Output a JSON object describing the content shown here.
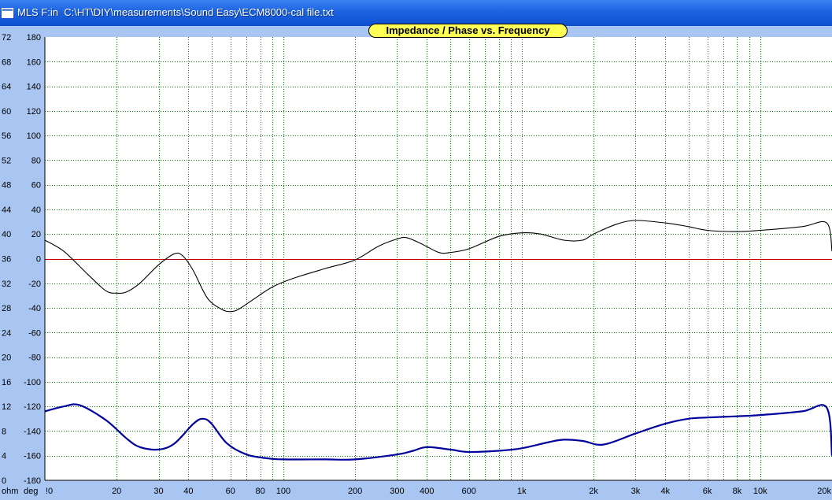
{
  "window": {
    "app": "MLS F:in",
    "path": "C:\\HT\\DIY\\measurements\\Sound Easy\\ECM8000-cal file.txt"
  },
  "colors": {
    "plot_background": "#ffffff",
    "grid": "#008000",
    "reference_line": "#c00000",
    "impedance": "#000000",
    "phase": "#00009c",
    "title_box": "#ffff55"
  },
  "chart_data": {
    "type": "line",
    "title": "Impedance / Phase vs. Frequency",
    "xscale": "log",
    "xlim": [
      10,
      20000
    ],
    "x_tick_labels": [
      {
        "value": 10,
        "label": "!0"
      },
      {
        "value": 20,
        "label": "20"
      },
      {
        "value": 30,
        "label": "30"
      },
      {
        "value": 40,
        "label": "40"
      },
      {
        "value": 60,
        "label": "60"
      },
      {
        "value": 80,
        "label": "80"
      },
      {
        "value": 100,
        "label": "100"
      },
      {
        "value": 200,
        "label": "200"
      },
      {
        "value": 300,
        "label": "300"
      },
      {
        "value": 400,
        "label": "400"
      },
      {
        "value": 600,
        "label": "600"
      },
      {
        "value": 1000,
        "label": "1k"
      },
      {
        "value": 2000,
        "label": "2k"
      },
      {
        "value": 3000,
        "label": "3k"
      },
      {
        "value": 4000,
        "label": "4k"
      },
      {
        "value": 6000,
        "label": "6k"
      },
      {
        "value": 8000,
        "label": "8k"
      },
      {
        "value": 10000,
        "label": "10k"
      },
      {
        "value": 20000,
        "label": "20k"
      }
    ],
    "x_gridlines": [
      10,
      20,
      30,
      40,
      50,
      60,
      70,
      80,
      90,
      100,
      200,
      300,
      400,
      500,
      600,
      700,
      800,
      900,
      1000,
      2000,
      3000,
      4000,
      5000,
      6000,
      7000,
      8000,
      9000,
      10000,
      20000
    ],
    "y_left": {
      "unit_label": "ohm",
      "ylim": [
        0,
        72
      ],
      "ticks": [
        "72",
        "68",
        "64",
        "60",
        "56",
        "52",
        "48",
        "44",
        "40",
        "36",
        "32",
        "28",
        "24",
        "20",
        "16",
        "12",
        "8",
        "4",
        "0"
      ]
    },
    "y_right": {
      "unit_label": "deg",
      "ylim": [
        -180,
        180
      ],
      "ticks": [
        "180",
        "160",
        "140",
        "120",
        "100",
        "80",
        "60",
        "40",
        "20",
        "0",
        "-20",
        "-40",
        "-60",
        "-80",
        "-100",
        "-120",
        "-140",
        "-160",
        "-180"
      ]
    },
    "grid": true,
    "reference_line": {
      "axis": "deg",
      "value": 0
    },
    "series": [
      {
        "axis": "deg",
        "color": "#000000",
        "points": [
          [
            10,
            15
          ],
          [
            12,
            6
          ],
          [
            15,
            -12
          ],
          [
            18,
            -26
          ],
          [
            20,
            -28
          ],
          [
            22,
            -27
          ],
          [
            25,
            -20
          ],
          [
            30,
            -5
          ],
          [
            35,
            4
          ],
          [
            38,
            2
          ],
          [
            42,
            -10
          ],
          [
            48,
            -32
          ],
          [
            55,
            -41
          ],
          [
            60,
            -43
          ],
          [
            65,
            -41
          ],
          [
            75,
            -33
          ],
          [
            90,
            -23
          ],
          [
            110,
            -16
          ],
          [
            150,
            -8
          ],
          [
            200,
            -1
          ],
          [
            250,
            10
          ],
          [
            300,
            16
          ],
          [
            330,
            17
          ],
          [
            380,
            12
          ],
          [
            450,
            5
          ],
          [
            500,
            5
          ],
          [
            600,
            8
          ],
          [
            800,
            18
          ],
          [
            1000,
            21
          ],
          [
            1200,
            20
          ],
          [
            1500,
            15
          ],
          [
            1800,
            15
          ],
          [
            2000,
            20
          ],
          [
            2500,
            28
          ],
          [
            3000,
            31
          ],
          [
            4000,
            29
          ],
          [
            5000,
            26
          ],
          [
            6000,
            23
          ],
          [
            8000,
            22
          ],
          [
            10000,
            23
          ],
          [
            15000,
            26
          ],
          [
            19000,
            29
          ],
          [
            20000,
            6
          ]
        ]
      },
      {
        "axis": "deg",
        "color": "#00009c",
        "points": [
          [
            10,
            -124
          ],
          [
            12,
            -120
          ],
          [
            14,
            -119
          ],
          [
            18,
            -131
          ],
          [
            22,
            -146
          ],
          [
            25,
            -153
          ],
          [
            30,
            -155
          ],
          [
            35,
            -150
          ],
          [
            42,
            -134
          ],
          [
            46,
            -130
          ],
          [
            50,
            -134
          ],
          [
            58,
            -150
          ],
          [
            70,
            -159
          ],
          [
            85,
            -162
          ],
          [
            100,
            -163
          ],
          [
            150,
            -163
          ],
          [
            200,
            -163
          ],
          [
            300,
            -159
          ],
          [
            350,
            -156
          ],
          [
            400,
            -153
          ],
          [
            500,
            -155
          ],
          [
            600,
            -157
          ],
          [
            800,
            -156
          ],
          [
            1000,
            -154
          ],
          [
            1300,
            -149
          ],
          [
            1500,
            -147
          ],
          [
            1800,
            -148
          ],
          [
            2200,
            -151
          ],
          [
            3000,
            -142
          ],
          [
            4000,
            -134
          ],
          [
            5000,
            -130
          ],
          [
            6000,
            -129
          ],
          [
            8000,
            -128
          ],
          [
            10000,
            -127
          ],
          [
            15000,
            -124
          ],
          [
            19000,
            -121
          ],
          [
            20000,
            -160
          ]
        ]
      }
    ]
  }
}
